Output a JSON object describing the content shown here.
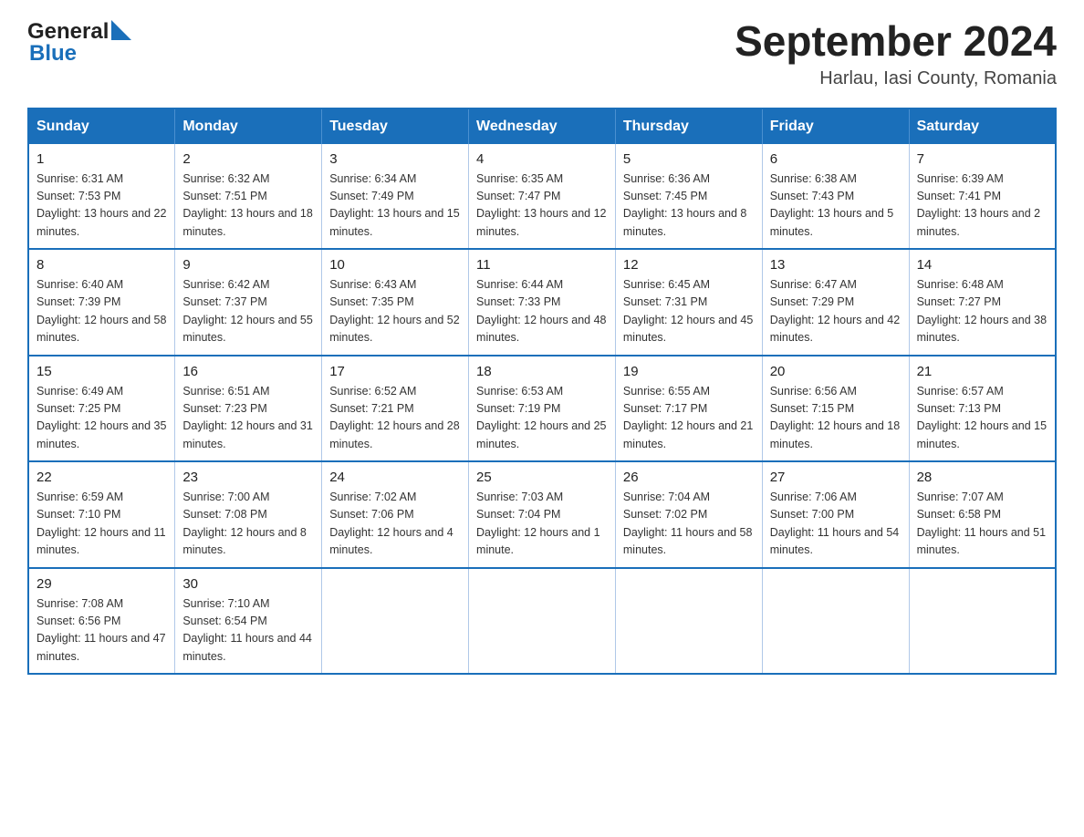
{
  "header": {
    "logo": {
      "general": "General",
      "blue": "Blue"
    },
    "title": "September 2024",
    "location": "Harlau, Iasi County, Romania"
  },
  "calendar": {
    "days_of_week": [
      "Sunday",
      "Monday",
      "Tuesday",
      "Wednesday",
      "Thursday",
      "Friday",
      "Saturday"
    ],
    "weeks": [
      [
        {
          "day": "1",
          "sunrise": "Sunrise: 6:31 AM",
          "sunset": "Sunset: 7:53 PM",
          "daylight": "Daylight: 13 hours and 22 minutes."
        },
        {
          "day": "2",
          "sunrise": "Sunrise: 6:32 AM",
          "sunset": "Sunset: 7:51 PM",
          "daylight": "Daylight: 13 hours and 18 minutes."
        },
        {
          "day": "3",
          "sunrise": "Sunrise: 6:34 AM",
          "sunset": "Sunset: 7:49 PM",
          "daylight": "Daylight: 13 hours and 15 minutes."
        },
        {
          "day": "4",
          "sunrise": "Sunrise: 6:35 AM",
          "sunset": "Sunset: 7:47 PM",
          "daylight": "Daylight: 13 hours and 12 minutes."
        },
        {
          "day": "5",
          "sunrise": "Sunrise: 6:36 AM",
          "sunset": "Sunset: 7:45 PM",
          "daylight": "Daylight: 13 hours and 8 minutes."
        },
        {
          "day": "6",
          "sunrise": "Sunrise: 6:38 AM",
          "sunset": "Sunset: 7:43 PM",
          "daylight": "Daylight: 13 hours and 5 minutes."
        },
        {
          "day": "7",
          "sunrise": "Sunrise: 6:39 AM",
          "sunset": "Sunset: 7:41 PM",
          "daylight": "Daylight: 13 hours and 2 minutes."
        }
      ],
      [
        {
          "day": "8",
          "sunrise": "Sunrise: 6:40 AM",
          "sunset": "Sunset: 7:39 PM",
          "daylight": "Daylight: 12 hours and 58 minutes."
        },
        {
          "day": "9",
          "sunrise": "Sunrise: 6:42 AM",
          "sunset": "Sunset: 7:37 PM",
          "daylight": "Daylight: 12 hours and 55 minutes."
        },
        {
          "day": "10",
          "sunrise": "Sunrise: 6:43 AM",
          "sunset": "Sunset: 7:35 PM",
          "daylight": "Daylight: 12 hours and 52 minutes."
        },
        {
          "day": "11",
          "sunrise": "Sunrise: 6:44 AM",
          "sunset": "Sunset: 7:33 PM",
          "daylight": "Daylight: 12 hours and 48 minutes."
        },
        {
          "day": "12",
          "sunrise": "Sunrise: 6:45 AM",
          "sunset": "Sunset: 7:31 PM",
          "daylight": "Daylight: 12 hours and 45 minutes."
        },
        {
          "day": "13",
          "sunrise": "Sunrise: 6:47 AM",
          "sunset": "Sunset: 7:29 PM",
          "daylight": "Daylight: 12 hours and 42 minutes."
        },
        {
          "day": "14",
          "sunrise": "Sunrise: 6:48 AM",
          "sunset": "Sunset: 7:27 PM",
          "daylight": "Daylight: 12 hours and 38 minutes."
        }
      ],
      [
        {
          "day": "15",
          "sunrise": "Sunrise: 6:49 AM",
          "sunset": "Sunset: 7:25 PM",
          "daylight": "Daylight: 12 hours and 35 minutes."
        },
        {
          "day": "16",
          "sunrise": "Sunrise: 6:51 AM",
          "sunset": "Sunset: 7:23 PM",
          "daylight": "Daylight: 12 hours and 31 minutes."
        },
        {
          "day": "17",
          "sunrise": "Sunrise: 6:52 AM",
          "sunset": "Sunset: 7:21 PM",
          "daylight": "Daylight: 12 hours and 28 minutes."
        },
        {
          "day": "18",
          "sunrise": "Sunrise: 6:53 AM",
          "sunset": "Sunset: 7:19 PM",
          "daylight": "Daylight: 12 hours and 25 minutes."
        },
        {
          "day": "19",
          "sunrise": "Sunrise: 6:55 AM",
          "sunset": "Sunset: 7:17 PM",
          "daylight": "Daylight: 12 hours and 21 minutes."
        },
        {
          "day": "20",
          "sunrise": "Sunrise: 6:56 AM",
          "sunset": "Sunset: 7:15 PM",
          "daylight": "Daylight: 12 hours and 18 minutes."
        },
        {
          "day": "21",
          "sunrise": "Sunrise: 6:57 AM",
          "sunset": "Sunset: 7:13 PM",
          "daylight": "Daylight: 12 hours and 15 minutes."
        }
      ],
      [
        {
          "day": "22",
          "sunrise": "Sunrise: 6:59 AM",
          "sunset": "Sunset: 7:10 PM",
          "daylight": "Daylight: 12 hours and 11 minutes."
        },
        {
          "day": "23",
          "sunrise": "Sunrise: 7:00 AM",
          "sunset": "Sunset: 7:08 PM",
          "daylight": "Daylight: 12 hours and 8 minutes."
        },
        {
          "day": "24",
          "sunrise": "Sunrise: 7:02 AM",
          "sunset": "Sunset: 7:06 PM",
          "daylight": "Daylight: 12 hours and 4 minutes."
        },
        {
          "day": "25",
          "sunrise": "Sunrise: 7:03 AM",
          "sunset": "Sunset: 7:04 PM",
          "daylight": "Daylight: 12 hours and 1 minute."
        },
        {
          "day": "26",
          "sunrise": "Sunrise: 7:04 AM",
          "sunset": "Sunset: 7:02 PM",
          "daylight": "Daylight: 11 hours and 58 minutes."
        },
        {
          "day": "27",
          "sunrise": "Sunrise: 7:06 AM",
          "sunset": "Sunset: 7:00 PM",
          "daylight": "Daylight: 11 hours and 54 minutes."
        },
        {
          "day": "28",
          "sunrise": "Sunrise: 7:07 AM",
          "sunset": "Sunset: 6:58 PM",
          "daylight": "Daylight: 11 hours and 51 minutes."
        }
      ],
      [
        {
          "day": "29",
          "sunrise": "Sunrise: 7:08 AM",
          "sunset": "Sunset: 6:56 PM",
          "daylight": "Daylight: 11 hours and 47 minutes."
        },
        {
          "day": "30",
          "sunrise": "Sunrise: 7:10 AM",
          "sunset": "Sunset: 6:54 PM",
          "daylight": "Daylight: 11 hours and 44 minutes."
        },
        null,
        null,
        null,
        null,
        null
      ]
    ]
  }
}
